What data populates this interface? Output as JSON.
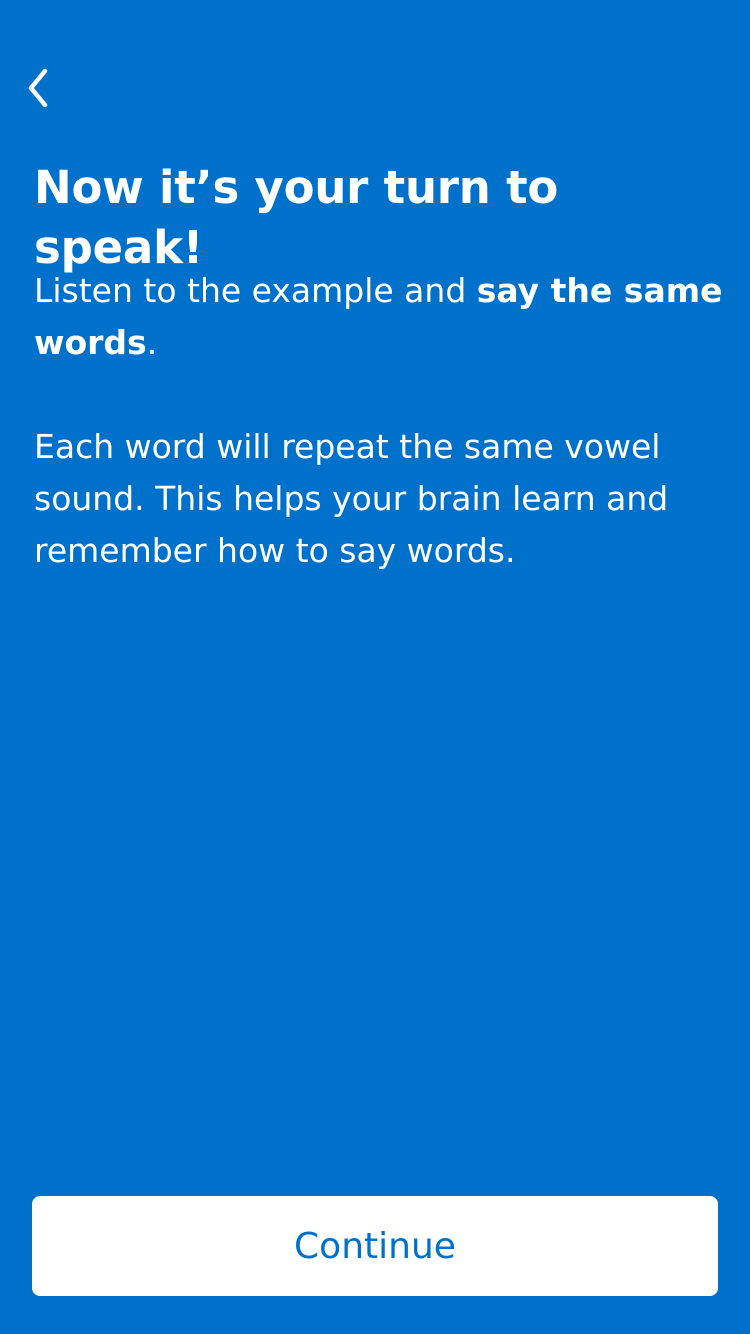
{
  "colors": {
    "background": "#0071CB",
    "text": "#FFFFFF",
    "button_background": "#FFFFFF",
    "button_text": "#0071CB"
  },
  "nav": {
    "back_icon": "chevron-left-icon"
  },
  "title": "Now it’s your turn to speak!",
  "intro": {
    "text_before": "Listen to the example and ",
    "text_bold": "say the same words",
    "text_after": "."
  },
  "explanation": "Each word will repeat the same vowel sound. This helps your brain learn and remember how to say words.",
  "continue_label": "Continue"
}
